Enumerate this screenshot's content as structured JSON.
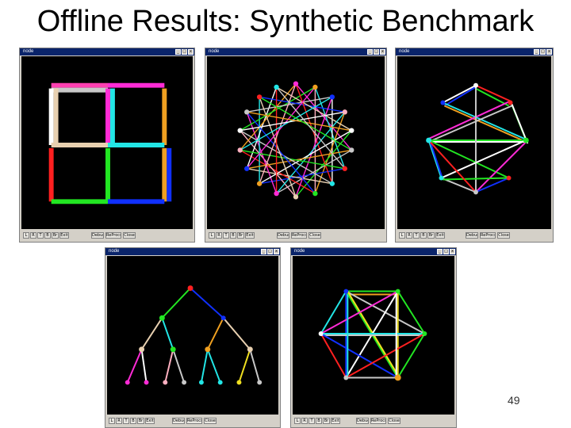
{
  "slide": {
    "title": "Offline Results: Synthetic Benchmark",
    "page_number": "49"
  },
  "colors": {
    "window_title": "#0a246a",
    "window_chrome": "#d4d0c8",
    "canvas": "#000000"
  },
  "windows": [
    {
      "title": "node",
      "nav_buttons": [
        "L",
        "R",
        "T",
        "B",
        "Br",
        "Exit"
      ],
      "action_buttons": [
        "Debug",
        "ReProcs",
        "Close"
      ]
    },
    {
      "title": "node",
      "nav_buttons": [
        "L",
        "R",
        "T",
        "B",
        "Br",
        "Exit"
      ],
      "action_buttons": [
        "Debug",
        "ReProcs",
        "Close"
      ]
    },
    {
      "title": "node",
      "nav_buttons": [
        "L",
        "R",
        "T",
        "B",
        "Br",
        "Exit"
      ],
      "action_buttons": [
        "Debug",
        "ReProcs",
        "Close"
      ]
    },
    {
      "title": "node",
      "nav_buttons": [
        "L",
        "R",
        "T",
        "B",
        "Br",
        "Exit"
      ],
      "action_buttons": [
        "Debug",
        "ReProcs",
        "Close"
      ]
    },
    {
      "title": "node",
      "nav_buttons": [
        "L",
        "R",
        "T",
        "B",
        "Br",
        "Exit"
      ],
      "action_buttons": [
        "Debug",
        "ReProcs",
        "Close"
      ]
    }
  ],
  "window_controls": [
    "_",
    "□",
    "x"
  ]
}
